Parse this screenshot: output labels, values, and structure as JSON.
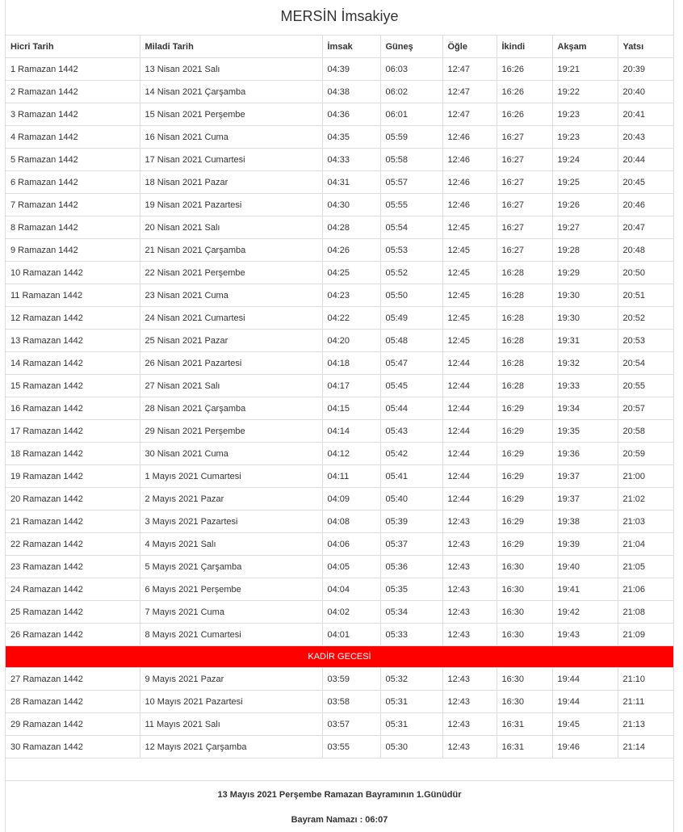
{
  "title": "MERSİN İmsakiye",
  "columns": [
    "Hicri Tarih",
    "Miladi Tarih",
    "İmsak",
    "Güneş",
    "Öğle",
    "İkindi",
    "Akşam",
    "Yatsı"
  ],
  "rows_before": [
    [
      "1 Ramazan 1442",
      "13 Nisan 2021 Salı",
      "04:39",
      "06:03",
      "12:47",
      "16:26",
      "19:21",
      "20:39"
    ],
    [
      "2 Ramazan 1442",
      "14 Nisan 2021 Çarşamba",
      "04:38",
      "06:02",
      "12:47",
      "16:26",
      "19:22",
      "20:40"
    ],
    [
      "3 Ramazan 1442",
      "15 Nisan 2021 Perşembe",
      "04:36",
      "06:01",
      "12:47",
      "16:26",
      "19:23",
      "20:41"
    ],
    [
      "4 Ramazan 1442",
      "16 Nisan 2021 Cuma",
      "04:35",
      "05:59",
      "12:46",
      "16:27",
      "19:23",
      "20:43"
    ],
    [
      "5 Ramazan 1442",
      "17 Nisan 2021 Cumartesi",
      "04:33",
      "05:58",
      "12:46",
      "16:27",
      "19:24",
      "20:44"
    ],
    [
      "6 Ramazan 1442",
      "18 Nisan 2021 Pazar",
      "04:31",
      "05:57",
      "12:46",
      "16:27",
      "19:25",
      "20:45"
    ],
    [
      "7 Ramazan 1442",
      "19 Nisan 2021 Pazartesi",
      "04:30",
      "05:55",
      "12:46",
      "16:27",
      "19:26",
      "20:46"
    ],
    [
      "8 Ramazan 1442",
      "20 Nisan 2021 Salı",
      "04:28",
      "05:54",
      "12:45",
      "16:27",
      "19:27",
      "20:47"
    ],
    [
      "9 Ramazan 1442",
      "21 Nisan 2021 Çarşamba",
      "04:26",
      "05:53",
      "12:45",
      "16:27",
      "19:28",
      "20:48"
    ],
    [
      "10 Ramazan 1442",
      "22 Nisan 2021 Perşembe",
      "04:25",
      "05:52",
      "12:45",
      "16:28",
      "19:29",
      "20:50"
    ],
    [
      "11 Ramazan 1442",
      "23 Nisan 2021 Cuma",
      "04:23",
      "05:50",
      "12:45",
      "16:28",
      "19:30",
      "20:51"
    ],
    [
      "12 Ramazan 1442",
      "24 Nisan 2021 Cumartesi",
      "04:22",
      "05:49",
      "12:45",
      "16:28",
      "19:30",
      "20:52"
    ],
    [
      "13 Ramazan 1442",
      "25 Nisan 2021 Pazar",
      "04:20",
      "05:48",
      "12:45",
      "16:28",
      "19:31",
      "20:53"
    ],
    [
      "14 Ramazan 1442",
      "26 Nisan 2021 Pazartesi",
      "04:18",
      "05:47",
      "12:44",
      "16:28",
      "19:32",
      "20:54"
    ],
    [
      "15 Ramazan 1442",
      "27 Nisan 2021 Salı",
      "04:17",
      "05:45",
      "12:44",
      "16:28",
      "19:33",
      "20:55"
    ],
    [
      "16 Ramazan 1442",
      "28 Nisan 2021 Çarşamba",
      "04:15",
      "05:44",
      "12:44",
      "16:29",
      "19:34",
      "20:57"
    ],
    [
      "17 Ramazan 1442",
      "29 Nisan 2021 Perşembe",
      "04:14",
      "05:43",
      "12:44",
      "16:29",
      "19:35",
      "20:58"
    ],
    [
      "18 Ramazan 1442",
      "30 Nisan 2021 Cuma",
      "04:12",
      "05:42",
      "12:44",
      "16:29",
      "19:36",
      "20:59"
    ],
    [
      "19 Ramazan 1442",
      "1 Mayıs 2021 Cumartesi",
      "04:11",
      "05:41",
      "12:44",
      "16:29",
      "19:37",
      "21:00"
    ],
    [
      "20 Ramazan 1442",
      "2 Mayıs 2021 Pazar",
      "04:09",
      "05:40",
      "12:44",
      "16:29",
      "19:37",
      "21:02"
    ],
    [
      "21 Ramazan 1442",
      "3 Mayıs 2021 Pazartesi",
      "04:08",
      "05:39",
      "12:43",
      "16:29",
      "19:38",
      "21:03"
    ],
    [
      "22 Ramazan 1442",
      "4 Mayıs 2021 Salı",
      "04:06",
      "05:37",
      "12:43",
      "16:29",
      "19:39",
      "21:04"
    ],
    [
      "23 Ramazan 1442",
      "5 Mayıs 2021 Çarşamba",
      "04:05",
      "05:36",
      "12:43",
      "16:30",
      "19:40",
      "21:05"
    ],
    [
      "24 Ramazan 1442",
      "6 Mayıs 2021 Perşembe",
      "04:04",
      "05:35",
      "12:43",
      "16:30",
      "19:41",
      "21:06"
    ],
    [
      "25 Ramazan 1442",
      "7 Mayıs 2021 Cuma",
      "04:02",
      "05:34",
      "12:43",
      "16:30",
      "19:42",
      "21:08"
    ],
    [
      "26 Ramazan 1442",
      "8 Mayıs 2021 Cumartesi",
      "04:01",
      "05:33",
      "12:43",
      "16:30",
      "19:43",
      "21:09"
    ]
  ],
  "kadir_label": "KADİR GECESİ",
  "kadir_color": "#ff0000",
  "rows_after": [
    [
      "27 Ramazan 1442",
      "9 Mayıs 2021 Pazar",
      "03:59",
      "05:32",
      "12:43",
      "16:30",
      "19:44",
      "21:10"
    ],
    [
      "28 Ramazan 1442",
      "10 Mayıs 2021 Pazartesi",
      "03:58",
      "05:31",
      "12:43",
      "16:30",
      "19:44",
      "21:11"
    ],
    [
      "29 Ramazan 1442",
      "11 Mayıs 2021 Salı",
      "03:57",
      "05:31",
      "12:43",
      "16:31",
      "19:45",
      "21:13"
    ],
    [
      "30 Ramazan 1442",
      "12 Mayıs 2021 Çarşamba",
      "03:55",
      "05:30",
      "12:43",
      "16:31",
      "19:46",
      "21:14"
    ]
  ],
  "footer": {
    "bayram_day": "13 Mayıs 2021 Perşembe Ramazan Bayramının 1.Günüdür",
    "bayram_namazi": "Bayram Namazı : 06:07"
  }
}
